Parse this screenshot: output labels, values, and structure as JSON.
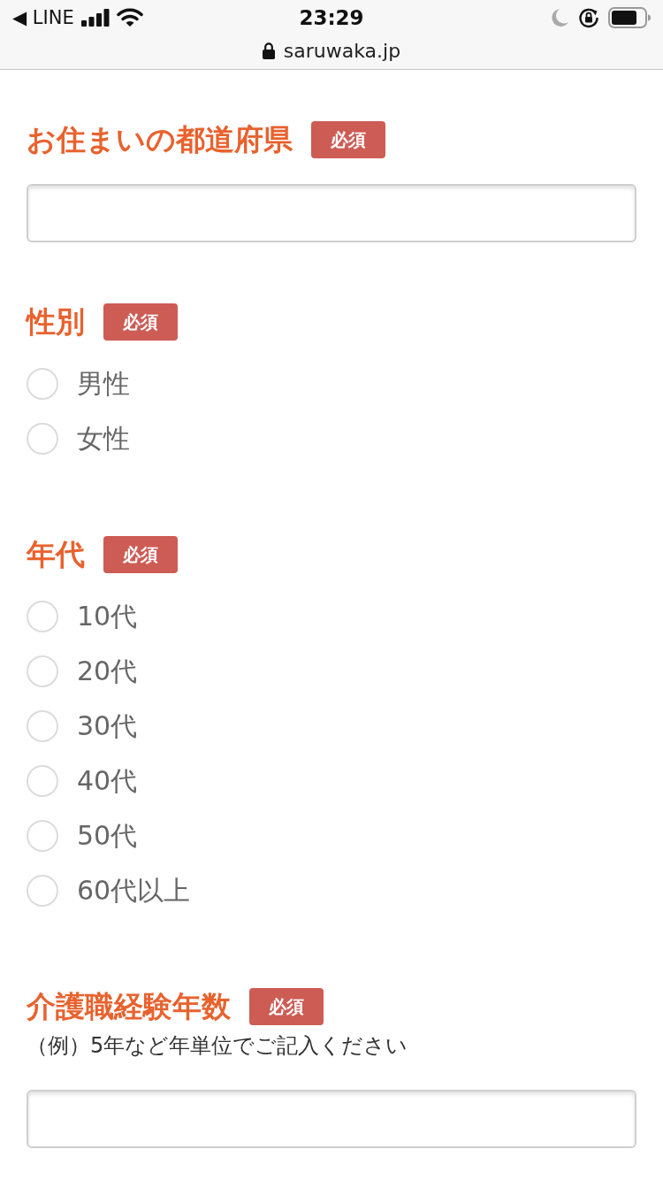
{
  "status_bar": {
    "back_link": "◀ LINE",
    "time": "23:29"
  },
  "address_bar": {
    "url": "saruwaka.jp"
  },
  "form": {
    "fields": [
      {
        "kind": "text",
        "label": "お住まいの都道府県",
        "badge": "必須"
      },
      {
        "kind": "radio",
        "label": "性別",
        "badge": "必須",
        "options": [
          {
            "label": "男性",
            "selected": false
          },
          {
            "label": "女性",
            "selected": false
          }
        ]
      },
      {
        "kind": "radio",
        "label": "年代",
        "badge": "必須",
        "options": [
          {
            "label": "10代",
            "selected": false
          },
          {
            "label": "20代",
            "selected": false
          },
          {
            "label": "30代",
            "selected": false
          },
          {
            "label": "40代",
            "selected": false
          },
          {
            "label": "50代",
            "selected": false
          },
          {
            "label": "60代以上",
            "selected": false
          }
        ]
      },
      {
        "kind": "text",
        "label": "介護職経験年数",
        "badge": "必須",
        "hint": "（例）5年など年単位でご記入ください"
      }
    ]
  }
}
